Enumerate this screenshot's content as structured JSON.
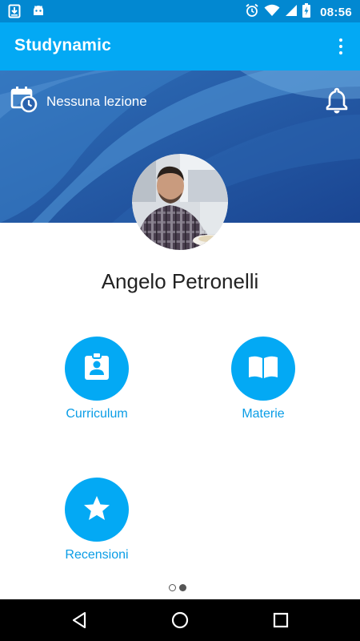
{
  "status_bar": {
    "time": "08:56",
    "left_icons": [
      "download-notification-icon",
      "android-notification-icon"
    ],
    "right_icons": [
      "alarm-icon",
      "wifi-icon",
      "cell-signal-icon",
      "battery-charging-icon"
    ]
  },
  "app_bar": {
    "title": "Studynamic",
    "menu_icon": "overflow-menu-icon"
  },
  "banner": {
    "lesson_status": "Nessuna lezione",
    "left_icon": "calendar-clock-icon",
    "right_icon": "bell-icon"
  },
  "profile": {
    "name": "Angelo Petronelli"
  },
  "menu": {
    "items": [
      {
        "label": "Curriculum",
        "icon": "clipboard-account-icon"
      },
      {
        "label": "Materie",
        "icon": "book-icon"
      },
      {
        "label": "Recensioni",
        "icon": "star-icon"
      }
    ]
  },
  "pager": {
    "pages": 2,
    "current": 2
  },
  "colors": {
    "primary": "#03a9f4",
    "primary_dark": "#0288d1",
    "label": "#0a9de6",
    "banner_dark": "#1e4a8f"
  },
  "nav_bar": {
    "buttons": [
      "back-icon",
      "home-icon",
      "recents-icon"
    ]
  }
}
